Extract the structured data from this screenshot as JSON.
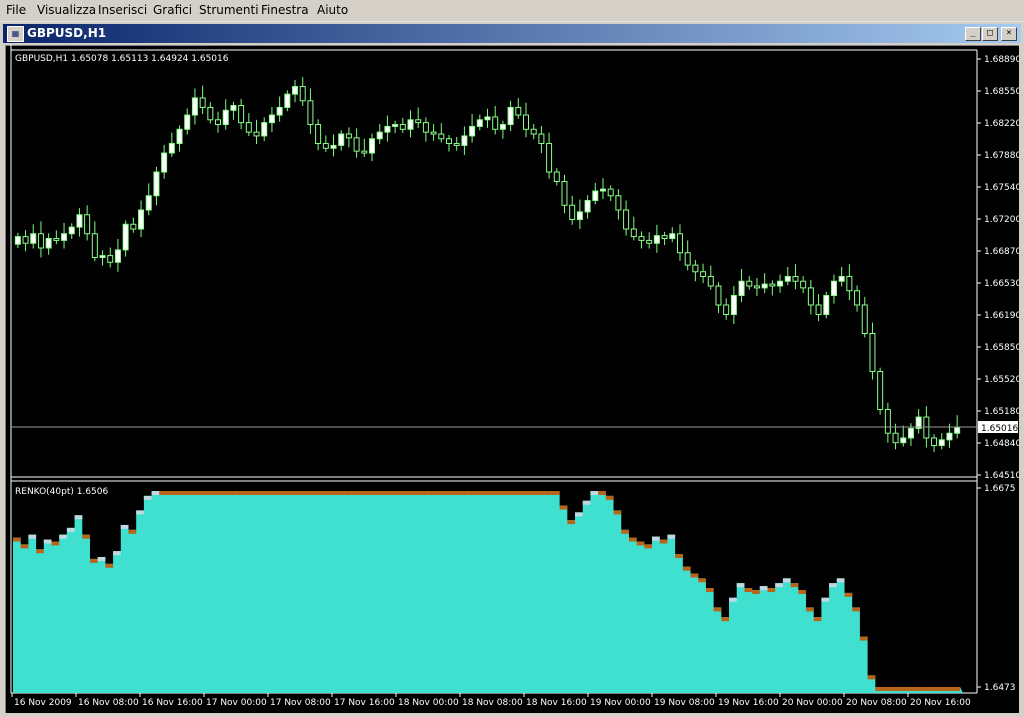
{
  "menu": [
    "File",
    "Visualizza",
    "Inserisci",
    "Grafici",
    "Strumenti",
    "Finestra",
    "Aiuto"
  ],
  "window": {
    "title": "GBPUSD,H1",
    "icon": "chart-window-icon",
    "buttons": [
      "minimize",
      "maximize",
      "close"
    ]
  },
  "main_chart": {
    "info": "GBPUSD,H1  1.65078 1.65113 1.64924 1.65016",
    "price_labels": [
      "1.68890",
      "1.68550",
      "1.68220",
      "1.67880",
      "1.67540",
      "1.67200",
      "1.66870",
      "1.66530",
      "1.66190",
      "1.65850",
      "1.65520",
      "1.65180",
      "1.64840",
      "1.64510"
    ],
    "current_price": "1.65016",
    "colors": {
      "bg": "#000000",
      "axis": "#ffffff",
      "bull_body": "#ffffff",
      "bull_outline": "#8cff8c",
      "wick": "#7cff7c",
      "bear_body": "#000000"
    }
  },
  "indicator": {
    "info": "RENKO(40pt) 1.6506",
    "price_labels": [
      "1.6675",
      "1.6473"
    ],
    "colors": {
      "fill": "#40e0d0",
      "up_step": "#c0d8e0",
      "down_step": "#b8651a"
    }
  },
  "time_labels": [
    "16 Nov 2009",
    "16 Nov 08:00",
    "16 Nov 16:00",
    "17 Nov 00:00",
    "17 Nov 08:00",
    "17 Nov 16:00",
    "18 Nov 00:00",
    "18 Nov 08:00",
    "18 Nov 16:00",
    "19 Nov 00:00",
    "19 Nov 08:00",
    "19 Nov 16:00",
    "20 Nov 00:00",
    "20 Nov 08:00",
    "20 Nov 16:00"
  ],
  "chart_data": {
    "type": "candlestick",
    "symbol": "GBPUSD",
    "timeframe": "H1",
    "y_range": [
      1.6451,
      1.6889
    ],
    "closes": [
      1.6702,
      1.6695,
      1.6705,
      1.669,
      1.67,
      1.6698,
      1.6705,
      1.6712,
      1.6725,
      1.6705,
      1.668,
      1.6682,
      1.6675,
      1.6688,
      1.6715,
      1.671,
      1.673,
      1.6745,
      1.677,
      1.679,
      1.68,
      1.6815,
      1.683,
      1.6848,
      1.6838,
      1.6825,
      1.682,
      1.6835,
      1.684,
      1.6822,
      1.6812,
      1.6808,
      1.6822,
      1.683,
      1.6838,
      1.6852,
      1.686,
      1.6845,
      1.682,
      1.68,
      1.6795,
      1.6798,
      1.681,
      1.6806,
      1.6792,
      1.679,
      1.6805,
      1.6812,
      1.6818,
      1.682,
      1.6815,
      1.6825,
      1.6822,
      1.6812,
      1.681,
      1.6805,
      1.68,
      1.6798,
      1.6808,
      1.6818,
      1.6825,
      1.6828,
      1.6815,
      1.682,
      1.6838,
      1.683,
      1.6815,
      1.681,
      1.68,
      1.677,
      1.676,
      1.6735,
      1.672,
      1.6728,
      1.674,
      1.675,
      1.6752,
      1.6745,
      1.673,
      1.671,
      1.6702,
      1.6698,
      1.6695,
      1.6703,
      1.67,
      1.6705,
      1.6685,
      1.6672,
      1.6665,
      1.666,
      1.665,
      1.663,
      1.662,
      1.664,
      1.6655,
      1.665,
      1.6648,
      1.6652,
      1.665,
      1.6655,
      1.666,
      1.6655,
      1.6648,
      1.663,
      1.662,
      1.664,
      1.6655,
      1.666,
      1.6645,
      1.663,
      1.66,
      1.656,
      1.652,
      1.6495,
      1.6485,
      1.649,
      1.65,
      1.6512,
      1.649,
      1.6482,
      1.6488,
      1.6495,
      1.6501
    ],
    "renko_range": [
      1.6473,
      1.6675
    ],
    "renko_closes_pt": "see main chart"
  }
}
